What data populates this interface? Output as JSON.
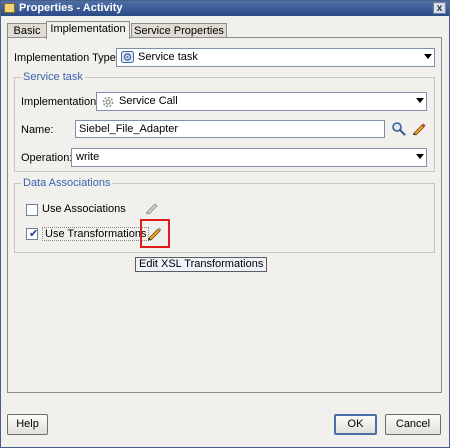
{
  "window": {
    "title": "Properties - Activity",
    "close_glyph": "x"
  },
  "tabs": [
    {
      "label": "Basic"
    },
    {
      "label": "Implementation"
    },
    {
      "label": "Service Properties"
    }
  ],
  "implementation_type": {
    "label": "Implementation Type:",
    "value": "Service task",
    "icon": "service-task-icon"
  },
  "service_task": {
    "title": "Service task",
    "implementation": {
      "label": "Implementation:",
      "value": "Service Call",
      "icon": "gear-icon"
    },
    "name": {
      "label": "Name:",
      "value": "Siebel_File_Adapter",
      "icons": [
        "search-icon",
        "edit-pencil-icon"
      ]
    },
    "operation": {
      "label": "Operation:",
      "value": "write"
    }
  },
  "data_associations": {
    "title": "Data Associations",
    "use_associations": {
      "label": "Use Associations",
      "checked": false
    },
    "use_transformations": {
      "label": "Use Transformations",
      "checked": true
    },
    "tooltip": "Edit XSL Transformations",
    "highlight_color": "#e01b1b"
  },
  "buttons": {
    "help": "Help",
    "ok": "OK",
    "cancel": "Cancel"
  },
  "colors": {
    "titlebar": "#2c4a86",
    "group_title": "#3b63b0",
    "window_bg": "#f1f0ec"
  }
}
